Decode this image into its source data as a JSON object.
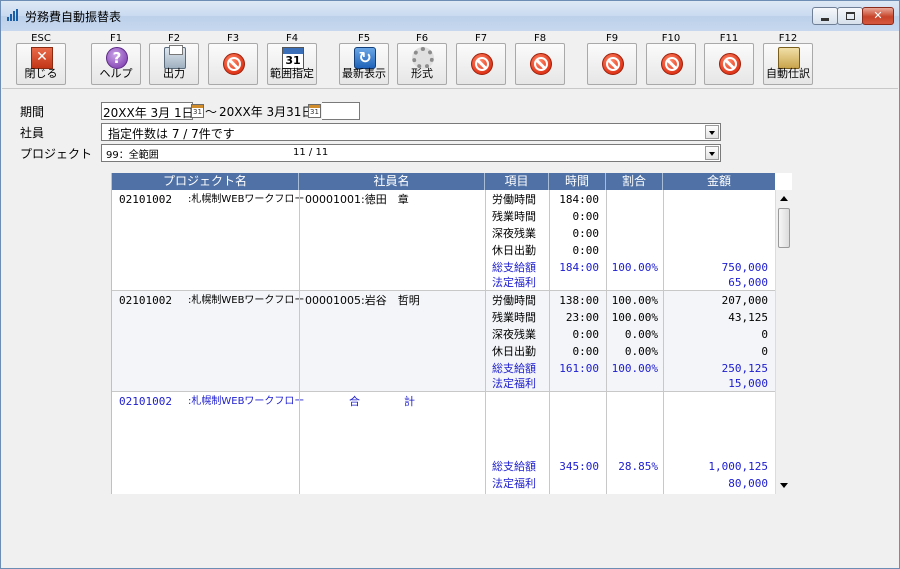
{
  "window": {
    "title": "労務費自動振替表"
  },
  "toolbar": [
    {
      "key": "ESC",
      "label": "閉じる",
      "icon": "close-icon"
    },
    {
      "key": "F1",
      "label": "ヘルプ",
      "icon": "help-icon"
    },
    {
      "key": "F2",
      "label": "出力",
      "icon": "print-icon"
    },
    {
      "key": "F3",
      "label": "",
      "icon": "disabled-icon"
    },
    {
      "key": "F4",
      "label": "範囲指定",
      "icon": "calendar-icon",
      "icon_text": "31"
    },
    {
      "key": "F5",
      "label": "最新表示",
      "icon": "refresh-icon"
    },
    {
      "key": "F6",
      "label": "形式",
      "icon": "gear-icon"
    },
    {
      "key": "F7",
      "label": "",
      "icon": "disabled-icon"
    },
    {
      "key": "F8",
      "label": "",
      "icon": "disabled-icon"
    },
    {
      "key": "F9",
      "label": "",
      "icon": "disabled-icon"
    },
    {
      "key": "F10",
      "label": "",
      "icon": "disabled-icon"
    },
    {
      "key": "F11",
      "label": "",
      "icon": "disabled-icon"
    },
    {
      "key": "F12",
      "label": "自動仕訳",
      "icon": "journal-icon"
    }
  ],
  "form": {
    "period_label": "期間",
    "period_from": "20XX年 3月 1日",
    "period_sep": "～",
    "period_to": "20XX年 3月31日",
    "employee_label": "社員",
    "employee_value": "指定件数は 7 / 7件です",
    "project_label": "プロジェクト",
    "project_value": "99：全範囲",
    "project_count": "11 / 11"
  },
  "grid": {
    "headers": [
      "プロジェクト名",
      "社員名",
      "項目",
      "時間",
      "割合",
      "金額"
    ],
    "records": [
      {
        "project_code": "02101002",
        "project_name": ":札幌制WEBワークフロー",
        "employee": "00001001:徳田　章",
        "lines": [
          {
            "item": "労働時間",
            "time": "184:00",
            "ratio": "",
            "amount": "",
            "total": false
          },
          {
            "item": "残業時間",
            "time": "0:00",
            "ratio": "",
            "amount": "",
            "total": false
          },
          {
            "item": "深夜残業",
            "time": "0:00",
            "ratio": "",
            "amount": "",
            "total": false
          },
          {
            "item": "休日出勤",
            "time": "0:00",
            "ratio": "",
            "amount": "",
            "total": false
          },
          {
            "item": "総支給額",
            "time": "184:00",
            "ratio": "100.00%",
            "amount": "750,000",
            "total": true
          },
          {
            "item": "法定福利",
            "time": "",
            "ratio": "",
            "amount": "65,000",
            "total": true
          }
        ]
      },
      {
        "project_code": "02101002",
        "project_name": ":札幌制WEBワークフロー",
        "employee": "00001005:岩谷　哲明",
        "lines": [
          {
            "item": "労働時間",
            "time": "138:00",
            "ratio": "100.00%",
            "amount": "207,000",
            "total": false
          },
          {
            "item": "残業時間",
            "time": "23:00",
            "ratio": "100.00%",
            "amount": "43,125",
            "total": false
          },
          {
            "item": "深夜残業",
            "time": "0:00",
            "ratio": "0.00%",
            "amount": "0",
            "total": false
          },
          {
            "item": "休日出勤",
            "time": "0:00",
            "ratio": "0.00%",
            "amount": "0",
            "total": false
          },
          {
            "item": "総支給額",
            "time": "161:00",
            "ratio": "100.00%",
            "amount": "250,125",
            "total": true
          },
          {
            "item": "法定福利",
            "time": "",
            "ratio": "",
            "amount": "15,000",
            "total": true
          }
        ]
      }
    ],
    "summary": {
      "project_code": "02101002",
      "project_name": ":札幌制WEBワークフロー",
      "employee_a": "合",
      "employee_b": "計",
      "lines": [
        {
          "item": "総支給額",
          "time": "345:00",
          "ratio": "28.85%",
          "amount": "1,000,125"
        },
        {
          "item": "法定福利",
          "time": "",
          "ratio": "",
          "amount": "80,000"
        }
      ]
    }
  },
  "colors": {
    "header_bg": "#4f71a6",
    "total_text": "#1c1ccf",
    "title_bar": "#c9daf0"
  }
}
